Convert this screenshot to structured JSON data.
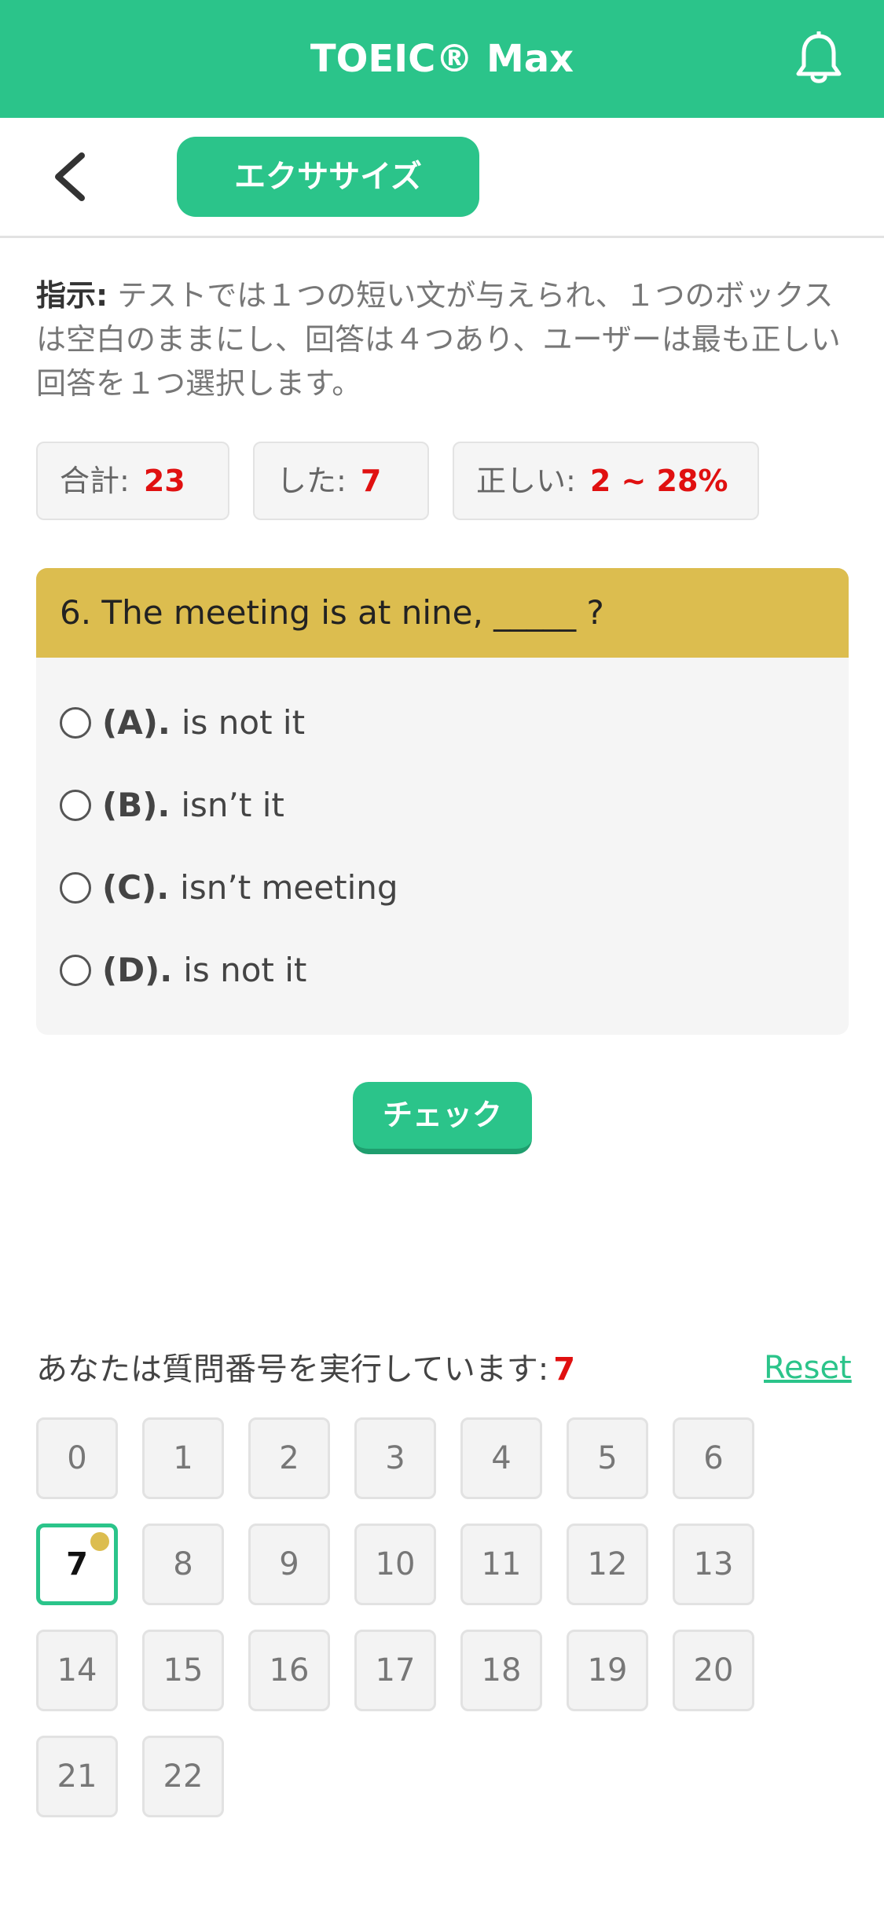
{
  "header": {
    "title": "TOEIC® Max",
    "bell_icon": "bell-icon",
    "color": "#2bc48a"
  },
  "subnav": {
    "back_icon": "chevron-left-icon",
    "section_label": "エクササイズ"
  },
  "instruction": {
    "label": "指示:",
    "text": " テストでは１つの短い文が与えられ、１つのボックスは空白のままにし、回答は４つあり、ユーザーは最も正しい回答を１つ選択します。"
  },
  "stats": {
    "total_label": "合計:",
    "total_value": "23",
    "done_label": "した:",
    "done_value": "7",
    "correct_label": "正しい:",
    "correct_value": "2 ~ 28%"
  },
  "question": {
    "text": "6. The meeting is at nine, _____ ?",
    "options": [
      {
        "key": "(A).",
        "text": "is not it"
      },
      {
        "key": "(B).",
        "text": "isn’t it"
      },
      {
        "key": "(C).",
        "text": "isn’t meeting"
      },
      {
        "key": "(D).",
        "text": "is not it"
      }
    ]
  },
  "check_label": "チェック",
  "progress": {
    "text": "あなたは質問番号を実行しています:",
    "current": "7",
    "reset_label": "Reset"
  },
  "numbers": [
    "0",
    "1",
    "2",
    "3",
    "4",
    "5",
    "6",
    "7",
    "8",
    "9",
    "10",
    "11",
    "12",
    "13",
    "14",
    "15",
    "16",
    "17",
    "18",
    "19",
    "20",
    "21",
    "22"
  ],
  "active_number": "7"
}
